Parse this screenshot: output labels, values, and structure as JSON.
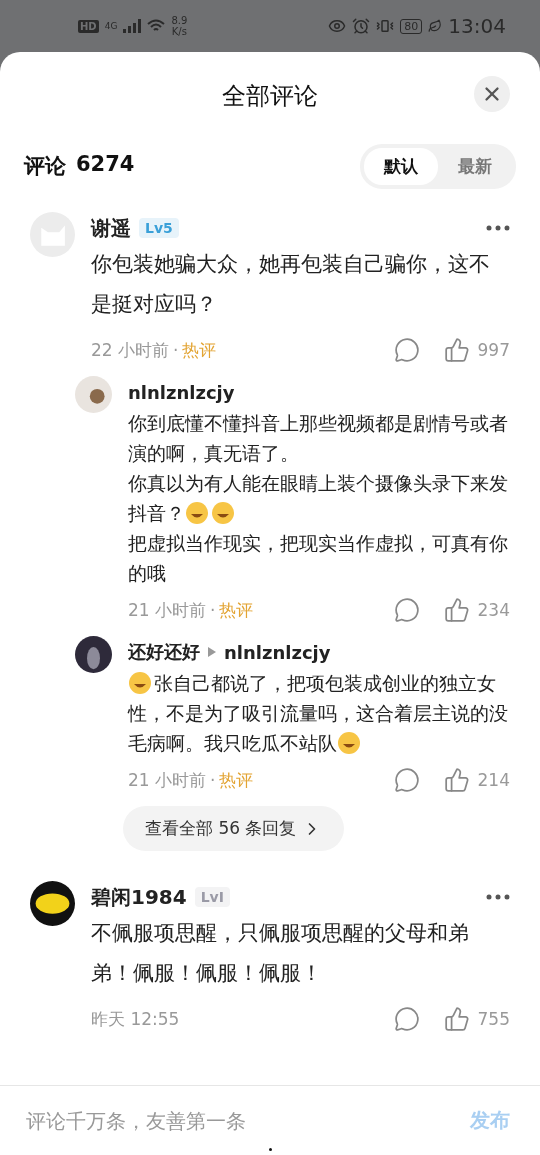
{
  "status_bar": {
    "hd": "HD",
    "network": "4G",
    "speed_value": "8.9",
    "speed_unit": "K/s",
    "battery": "80",
    "time": "13:04"
  },
  "sheet": {
    "title": "全部评论"
  },
  "comments_header": {
    "label": "评论",
    "count": "6274",
    "sort_tabs": [
      {
        "label": "默认",
        "selected": true
      },
      {
        "label": "最新",
        "selected": false
      }
    ]
  },
  "comments": [
    {
      "author": "谢遥",
      "level_badge": "Lv5",
      "color": "#3aa0d8",
      "paragraphs": [
        [
          {
            "kind": "text",
            "text": "你包装她骗大众，她再包装自己骗你，这不是挺对应吗？"
          }
        ]
      ],
      "time": "22 小时前",
      "separator": "·",
      "tag": "热评",
      "likes": "997",
      "replies": [
        {
          "author": "nlnlznlzcjy",
          "paragraphs": [
            [
              {
                "kind": "text",
                "text": "你到底懂不懂抖音上那些视频都是剧情号或者演的啊，真无语了。"
              }
            ],
            [
              {
                "kind": "text",
                "text": "你真以为有人能在眼睛上装个摄像头录下来发抖音？"
              },
              {
                "kind": "emoji"
              },
              {
                "kind": "emoji"
              }
            ],
            [
              {
                "kind": "text",
                "text": "把虚拟当作现实，把现实当作虚拟，可真有你的哦"
              }
            ]
          ],
          "time": "21 小时前",
          "separator": "·",
          "tag": "热评",
          "likes": "234"
        },
        {
          "author": "还好还好",
          "reply_to": "nlnlznlzcjy",
          "paragraphs": [
            [
              {
                "kind": "emoji"
              },
              {
                "kind": "text",
                "text": "张自己都说了，把项包装成创业的独立女性，不是为了吸引流量吗，这合着层主说的没毛病啊。我只吃瓜不站队"
              },
              {
                "kind": "emoji"
              }
            ]
          ],
          "time": "21 小时前",
          "separator": "·",
          "tag": "热评",
          "likes": "214"
        }
      ],
      "more_replies": "查看全部 56 条回复"
    },
    {
      "author": "碧闲1984",
      "level_badge": "LvI",
      "color": "#9a9aa6",
      "paragraphs": [
        [
          {
            "kind": "text",
            "text": "不佩服项思醒，只佩服项思醒的父母和弟弟！佩服！佩服！佩服！"
          }
        ]
      ],
      "time": "昨天 12:55",
      "likes": "755"
    }
  ],
  "input": {
    "placeholder": "评论千万条，友善第一条",
    "submit": "发布",
    "disabled": true
  }
}
